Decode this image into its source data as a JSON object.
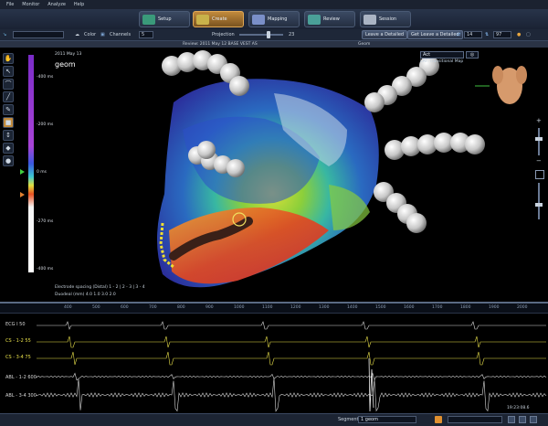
{
  "menu": [
    "File",
    "Monitor",
    "Analyze",
    "Help"
  ],
  "tabs": [
    {
      "label": "Setup",
      "color": "#3a9a7a"
    },
    {
      "label": "Create",
      "color": "#c9b24a"
    },
    {
      "label": "Mapping",
      "color": "#7a8fc8"
    },
    {
      "label": "Review",
      "color": "#4aa098"
    },
    {
      "label": "Session",
      "color": "#aab4c4"
    }
  ],
  "toolbar": {
    "color_label": "Color",
    "channels_label": "Channels",
    "channels_value": "5",
    "projection_label": "Projection",
    "projection_value": "23",
    "left_btn": "Leave a Detailed",
    "right_btn": "Get Leave a Detailed",
    "field_a": "14",
    "field_b": "97"
  },
  "title_strip": {
    "center": "Review: 2011 May 12  BASE  VEST  AS",
    "right_a": "Geom"
  },
  "scale": {
    "date": "2011 May 13",
    "name": "geom",
    "labels": [
      "-400 ms",
      "-200 ms",
      "0 ms",
      "-270 ms",
      "-400 ms"
    ]
  },
  "map_select": {
    "value": "Act",
    "sub": "LAT: Transitional Map"
  },
  "electrode_info": {
    "line1": "Electrode spacing (Distal)  1 - 2  |  2 - 3  |  3 - 4",
    "line2": "Duodeal (mm)     4.0    1.0    3.0    2.0"
  },
  "ecg": {
    "channels": [
      {
        "name": "ECG I 50",
        "color": "#d8d8d8"
      },
      {
        "name": "CS - 1-2 55",
        "color": "#e8e04a"
      },
      {
        "name": "CS - 3-4 75",
        "color": "#e8e04a"
      },
      {
        "name": "ABL - 1-2 600",
        "color": "#d8d8d8"
      },
      {
        "name": "ABL - 3-4 300",
        "color": "#d8d8d8"
      }
    ],
    "ticks": [
      "400",
      "500",
      "600",
      "700",
      "800",
      "900",
      "1000",
      "1100",
      "1200",
      "1300",
      "1400",
      "1500",
      "1600",
      "1700",
      "1800",
      "1900",
      "2000"
    ],
    "time": "19:23:08.6"
  },
  "status": {
    "segment_label": "Segment",
    "segment_value": "1 geom"
  }
}
